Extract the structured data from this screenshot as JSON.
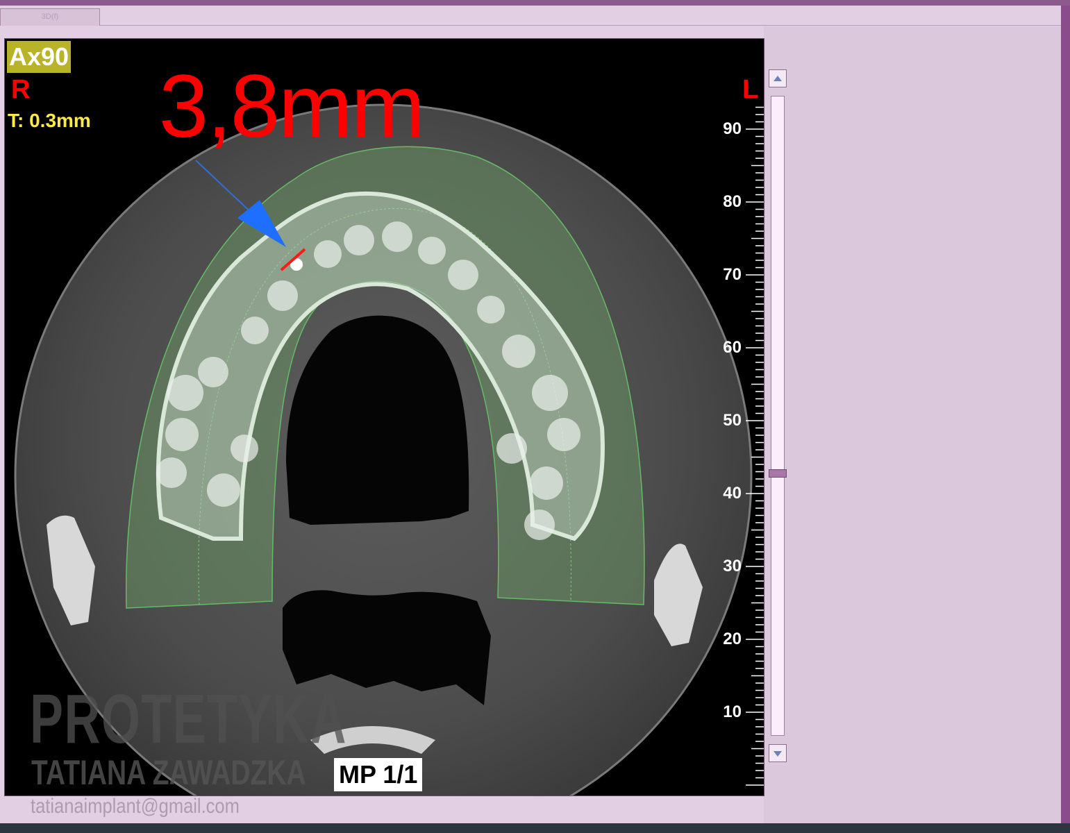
{
  "window": {
    "tab_label": "3D(f)"
  },
  "viewer": {
    "view_label": "Ax90",
    "orientation_right": "R",
    "orientation_left": "L",
    "thickness": "T: 0.3mm",
    "measurement": "3,8mm",
    "page_indicator": "MP 1/1",
    "watermark_line1": "PROTETYKA",
    "watermark_line2": "TATIANA ZAWADZKA",
    "watermark_email": "tatianaimplant@gmail.com",
    "ruler_labels": [
      "90",
      "80",
      "70",
      "60",
      "50",
      "40",
      "30",
      "20",
      "10"
    ]
  },
  "slider": {
    "level_fraction": 0.59
  },
  "colors": {
    "frame": "#8d5a8d",
    "panel": "#dcc8dc",
    "measurement": "#ff0000",
    "arch_overlay": "#66bb66",
    "arrow": "#1f6fff"
  }
}
